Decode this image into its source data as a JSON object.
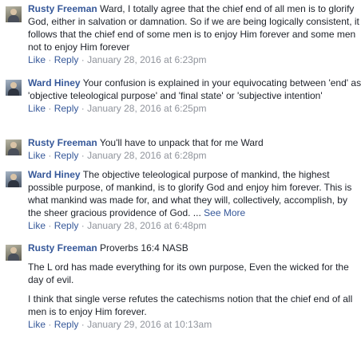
{
  "comments": [
    {
      "author": "Rusty Freeman",
      "text": "Ward, I totally agree that the chief end of all men is to glorify God, either in salvation or damnation. So if we are being logically consistent, it follows that the chief end of some men is to enjoy Him forever and some men not to enjoy Him forever",
      "like": "Like",
      "reply": "Reply",
      "timestamp": "January 28, 2016 at 6:23pm"
    },
    {
      "author": "Ward Hiney",
      "text": "Your confusion is explained in your equivocating between 'end' as 'objective teleological purpose' and 'final state' or 'subjective intention'",
      "like": "Like",
      "reply": "Reply",
      "timestamp": "January 28, 2016 at 6:25pm"
    },
    {
      "author": "Rusty Freeman",
      "text": "You'll have to unpack that for me Ward",
      "like": "Like",
      "reply": "Reply",
      "timestamp": "January 28, 2016 at 6:28pm"
    },
    {
      "author": "Ward Hiney",
      "text": "The objective teleological purpose of mankind, the highest possible purpose, of mankind, is to glorify God and enjoy him forever. This is what mankind was made for, and what they will, collectively, accomplish, by the sheer gracious providence of God. ...",
      "see_more": "See More",
      "like": "Like",
      "reply": "Reply",
      "timestamp": "January 28, 2016 at 6:48pm"
    },
    {
      "author": "Rusty Freeman",
      "text": "Proverbs 16:4 NASB",
      "para2": "The L ord has made everything for its own purpose, Even the wicked for the day of evil.",
      "para3": "I think that single verse refutes the catechisms notion that the chief end of all men is to enjoy Him forever.",
      "like": "Like",
      "reply": "Reply",
      "timestamp": "January 29, 2016 at 10:13am"
    }
  ],
  "separator": "·"
}
